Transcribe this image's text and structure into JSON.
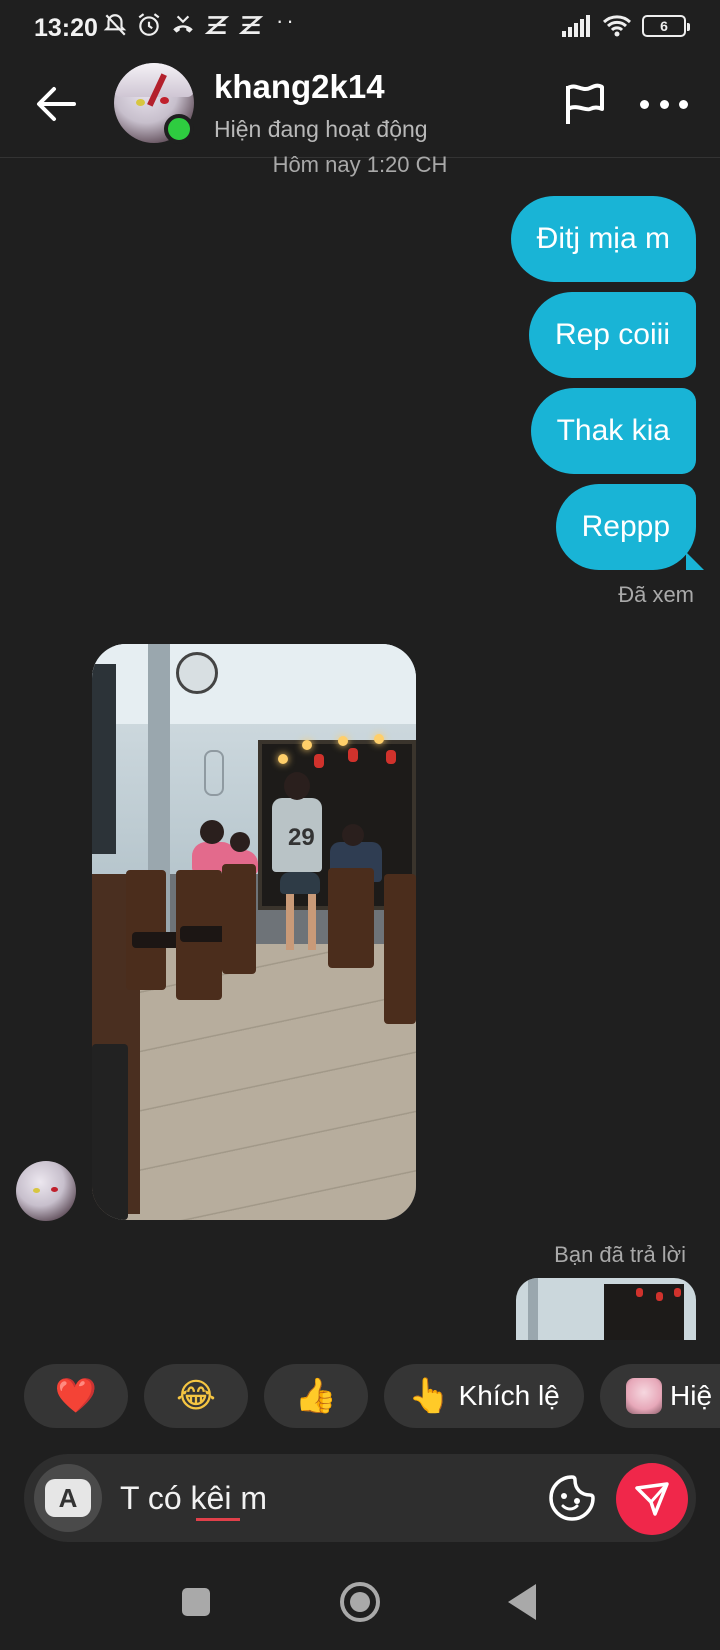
{
  "status_bar": {
    "time": "13:20",
    "battery": "6",
    "overflow_indicator": "··",
    "icons_left": [
      "bell-off-icon",
      "alarm-icon",
      "missed-call-icon",
      "app-icon",
      "app-icon"
    ],
    "icons_right": [
      "signal-icon",
      "wifi-icon",
      "battery-icon"
    ]
  },
  "header": {
    "username": "khang2k14",
    "status": "Hiện đang hoạt động",
    "online": true,
    "actions": [
      "back-arrow-icon",
      "flag-icon",
      "more-icon"
    ]
  },
  "chat": {
    "timestamp": "Hôm nay 1:20 CH",
    "outgoing": [
      {
        "text": "Đitj mịa m"
      },
      {
        "text": "Rep coiii"
      },
      {
        "text": "Thak kia"
      },
      {
        "text": "Reppp"
      }
    ],
    "seen_label": "Đã xem",
    "incoming_photo": {
      "overlay_text": "29"
    },
    "replied_label": "Bạn đã trả lời"
  },
  "quick_reactions": [
    {
      "emoji": "❤️",
      "label": ""
    },
    {
      "emoji": "😂",
      "label": ""
    },
    {
      "emoji": "👍",
      "label": ""
    },
    {
      "emoji": "👆",
      "label": "Khích lệ"
    },
    {
      "emoji": "",
      "label": "Hiệ"
    }
  ],
  "composer": {
    "keyboard_key": "A",
    "input_value": "T có kêi m",
    "icons": [
      "sticker-icon",
      "send-icon"
    ]
  },
  "colors": {
    "background": "#1f1f1f",
    "bubble": "#19b4d6",
    "online": "#2ecc40",
    "send": "#f0274a",
    "chip": "#353535"
  }
}
